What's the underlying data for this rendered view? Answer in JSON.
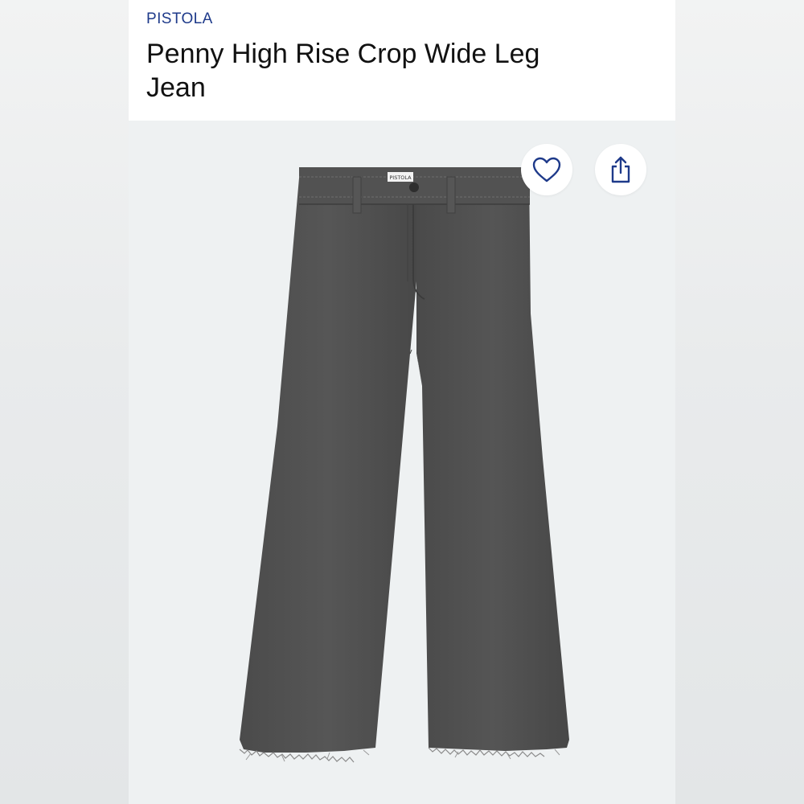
{
  "product": {
    "brand": "PISTOLA",
    "title": "Penny High Rise Crop Wide Leg Jean",
    "label_tag": "PISTOLA"
  },
  "actions": {
    "like_icon": "heart-outline-icon",
    "share_icon": "share-upload-icon"
  },
  "colors": {
    "brand": "#1e3a8a",
    "denim": "#4a4a4a",
    "media_background": "#eef1f2"
  }
}
